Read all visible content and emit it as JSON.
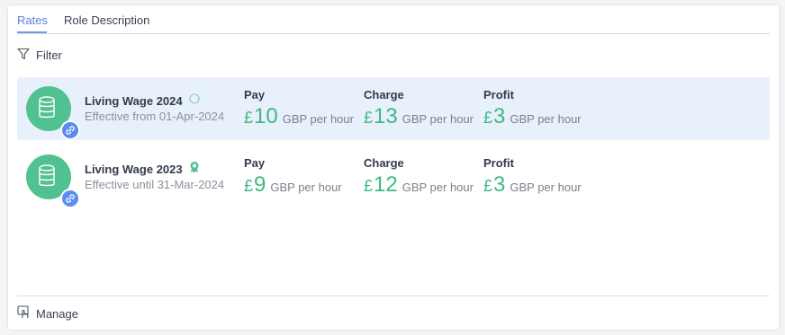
{
  "tabs": [
    {
      "label": "Rates",
      "active": true
    },
    {
      "label": "Role Description",
      "active": false
    }
  ],
  "filter": {
    "label": "Filter",
    "icon": "filter-icon"
  },
  "rates": [
    {
      "title": "Living Wage 2024",
      "status_icon": "pending-cycle-icon",
      "subtitle": "Effective from 01-Apr-2024",
      "selected": true,
      "pay": {
        "label": "Pay",
        "currency": "£",
        "amount": "10",
        "unit": "GBP per hour"
      },
      "charge": {
        "label": "Charge",
        "currency": "£",
        "amount": "13",
        "unit": "GBP per hour"
      },
      "profit": {
        "label": "Profit",
        "currency": "£",
        "amount": "3",
        "unit": "GBP per hour"
      }
    },
    {
      "title": "Living Wage 2023",
      "status_icon": "award-ribbon-icon",
      "subtitle": "Effective until 31-Mar-2024",
      "selected": false,
      "pay": {
        "label": "Pay",
        "currency": "£",
        "amount": "9",
        "unit": "GBP per hour"
      },
      "charge": {
        "label": "Charge",
        "currency": "£",
        "amount": "12",
        "unit": "GBP per hour"
      },
      "profit": {
        "label": "Profit",
        "currency": "£",
        "amount": "3",
        "unit": "GBP per hour"
      }
    }
  ],
  "footer": {
    "manage_label": "Manage",
    "icon": "manage-hand-icon"
  },
  "colors": {
    "accent": "#5b7fe0",
    "money_green": "#3fb883",
    "avatar_green": "#52c192",
    "link_badge_blue": "#5b8cf0",
    "selected_row_bg": "#e8f1fb"
  }
}
